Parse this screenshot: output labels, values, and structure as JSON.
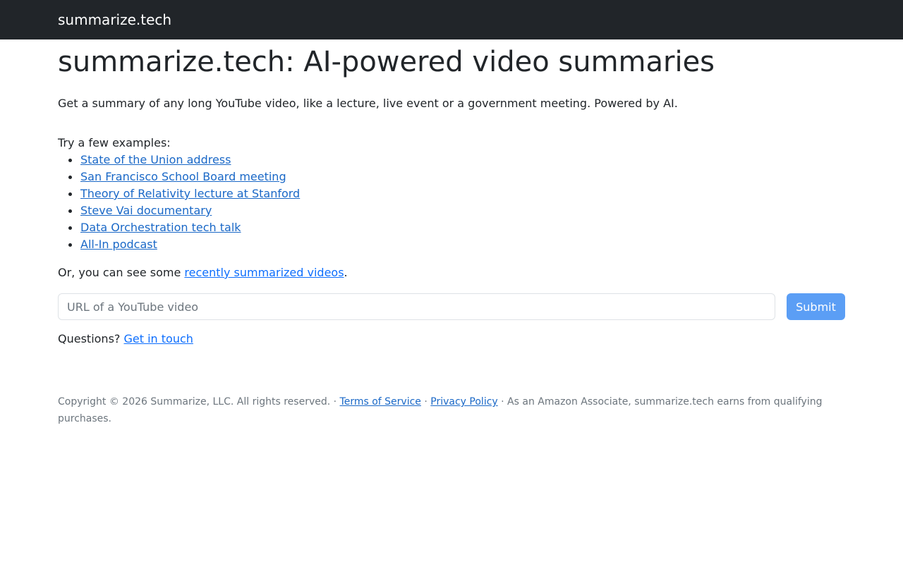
{
  "navbar": {
    "brand": "summarize.tech"
  },
  "header": {
    "title": "summarize.tech: AI-powered video summaries"
  },
  "intro": "Get a summary of any long YouTube video, like a lecture, live event or a government meeting. Powered by AI.",
  "examples": {
    "label": "Try a few examples:",
    "items": [
      "State of the Union address",
      "San Francisco School Board meeting",
      "Theory of Relativity lecture at Stanford",
      "Steve Vai documentary",
      "Data Orchestration tech talk",
      "All-In podcast"
    ]
  },
  "recent": {
    "prefix": "Or, you can see some ",
    "link": "recently summarized videos",
    "suffix": "."
  },
  "form": {
    "placeholder": "URL of a YouTube video",
    "value": "",
    "submit_label": "Submit"
  },
  "questions": {
    "prefix": "Questions? ",
    "link": "Get in touch"
  },
  "footer": {
    "copyright": "Copyright © 2026 Summarize, LLC. All rights reserved. · ",
    "terms": "Terms of Service",
    "sep": " · ",
    "privacy": "Privacy Policy",
    "amazon": " · As an Amazon Associate, summarize.tech earns from qualifying purchases."
  },
  "colors": {
    "navbar_bg": "#212529",
    "link": "#1a68c7",
    "button_bg": "#5b9ef5",
    "muted_text": "#6c757d"
  }
}
